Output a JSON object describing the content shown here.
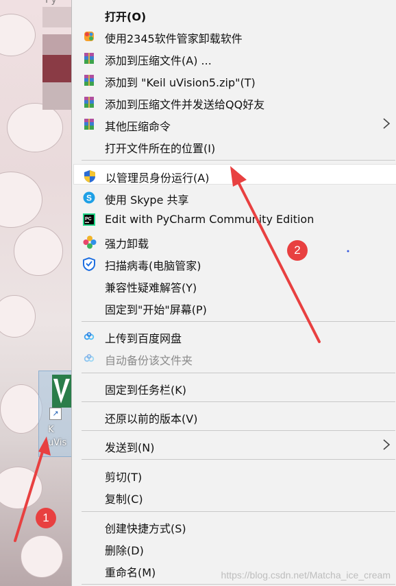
{
  "desktop": {
    "top_label": "Py",
    "shortcut_label": "K\nuVis"
  },
  "menu": {
    "items": [
      {
        "label": "打开(O)",
        "icon": "none"
      },
      {
        "label": "使用2345软件管家卸载软件",
        "icon": "2345-icon"
      },
      {
        "label": "添加到压缩文件(A) ...",
        "icon": "winrar-icon"
      },
      {
        "label": "添加到 \"Keil uVision5.zip\"(T)",
        "icon": "winrar-icon"
      },
      {
        "label": "添加到压缩文件并发送给QQ好友",
        "icon": "winrar-icon"
      },
      {
        "label": "其他压缩命令",
        "icon": "winrar-icon",
        "submenu": true
      },
      {
        "label": "打开文件所在的位置(I)",
        "icon": "none"
      },
      {
        "label": "以管理员身份运行(A)",
        "icon": "uac-shield-icon"
      },
      {
        "label": "使用 Skype 共享",
        "icon": "skype-icon"
      },
      {
        "label": "Edit with PyCharm Community Edition",
        "icon": "pycharm-icon"
      },
      {
        "label": "强力卸载",
        "icon": "uninstall-icon"
      },
      {
        "label": "扫描病毒(电脑管家)",
        "icon": "antivirus-shield-icon"
      },
      {
        "label": "兼容性疑难解答(Y)",
        "icon": "none"
      },
      {
        "label": "固定到\"开始\"屏幕(P)",
        "icon": "none"
      },
      {
        "label": "上传到百度网盘",
        "icon": "baidu-cloud-icon"
      },
      {
        "label": "自动备份该文件夹",
        "icon": "baidu-cloud-icon",
        "disabled": true
      },
      {
        "label": "固定到任务栏(K)",
        "icon": "none"
      },
      {
        "label": "还原以前的版本(V)",
        "icon": "none"
      },
      {
        "label": "发送到(N)",
        "icon": "none",
        "submenu": true
      },
      {
        "label": "剪切(T)",
        "icon": "none"
      },
      {
        "label": "复制(C)",
        "icon": "none"
      },
      {
        "label": "创建快捷方式(S)",
        "icon": "none"
      },
      {
        "label": "删除(D)",
        "icon": "none"
      },
      {
        "label": "重命名(M)",
        "icon": "none"
      }
    ]
  },
  "annotations": {
    "badge_1": "1",
    "badge_2": "2",
    "color": "#e84040"
  },
  "watermark": "https://blog.csdn.net/Matcha_ice_cream"
}
